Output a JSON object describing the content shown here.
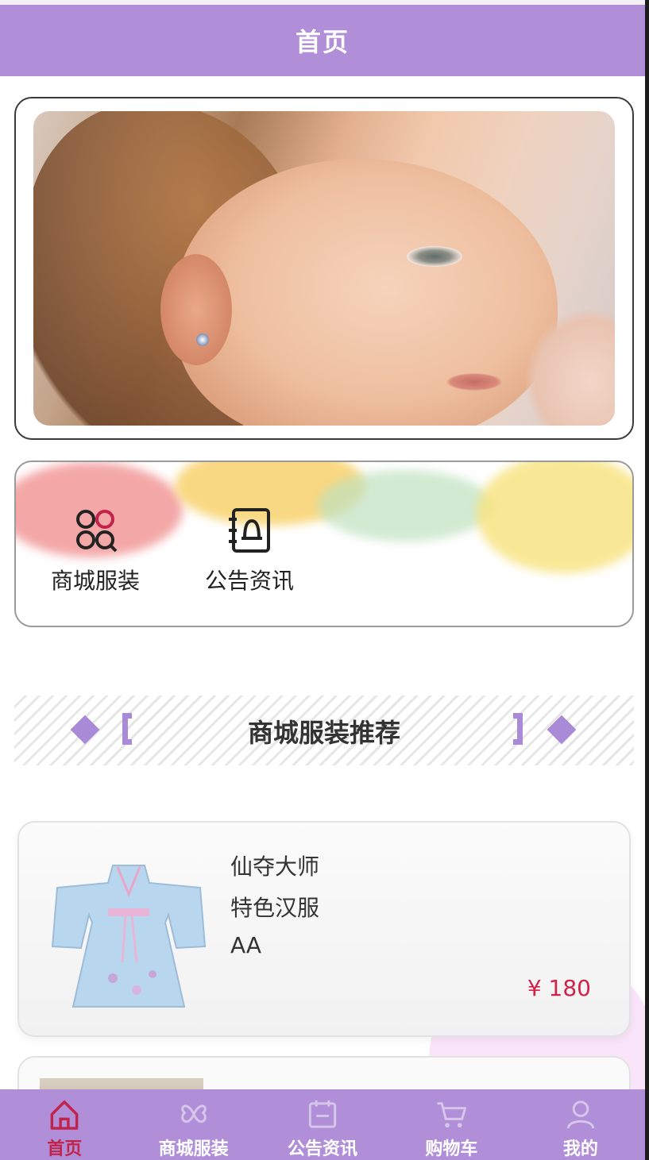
{
  "header": {
    "title": "首页"
  },
  "menu": {
    "items": [
      {
        "label": "商城服装",
        "icon": "grid-circles-icon"
      },
      {
        "label": "公告资讯",
        "icon": "notice-book-icon"
      }
    ]
  },
  "section": {
    "title": "商城服装推荐"
  },
  "product": {
    "line1": "仙夺大师",
    "line2": "特色汉服",
    "line3": "AA",
    "price": "¥ 180"
  },
  "tabbar": {
    "items": [
      {
        "label": "首页",
        "icon": "home-icon",
        "active": true
      },
      {
        "label": "商城服装",
        "icon": "clover-icon",
        "active": false
      },
      {
        "label": "公告资讯",
        "icon": "calendar-icon",
        "active": false
      },
      {
        "label": "购物车",
        "icon": "cart-icon",
        "active": false
      },
      {
        "label": "我的",
        "icon": "user-icon",
        "active": false
      }
    ]
  },
  "colors": {
    "primary": "#b08fd8",
    "active_tab": "#c2234a",
    "price": "#d0224b"
  }
}
